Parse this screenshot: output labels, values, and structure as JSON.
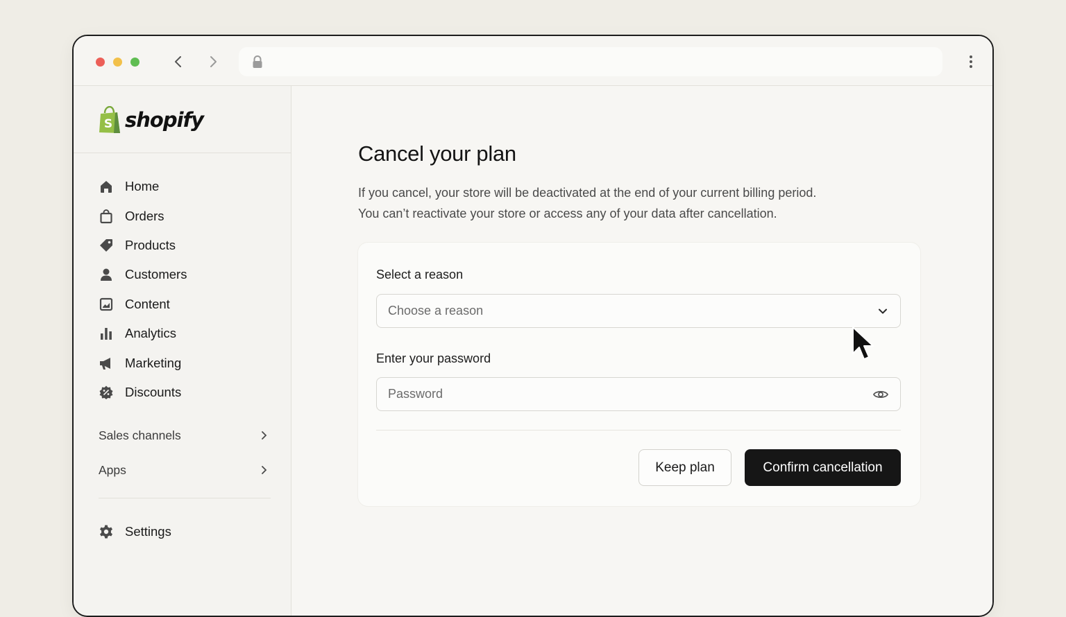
{
  "browser": {
    "url": "",
    "traffic_lights": {
      "close": "#ec5f58",
      "minimize": "#f2c04a",
      "zoom": "#5fbd52"
    }
  },
  "sidebar": {
    "brand": "shopify",
    "brand_color": "#95bf47",
    "items": [
      {
        "label": "Home",
        "icon": "home-icon"
      },
      {
        "label": "Orders",
        "icon": "orders-icon"
      },
      {
        "label": "Products",
        "icon": "tag-icon"
      },
      {
        "label": "Customers",
        "icon": "person-icon"
      },
      {
        "label": "Content",
        "icon": "content-icon"
      },
      {
        "label": "Analytics",
        "icon": "bar-chart-icon"
      },
      {
        "label": "Marketing",
        "icon": "megaphone-icon"
      },
      {
        "label": "Discounts",
        "icon": "discount-icon"
      }
    ],
    "sections": [
      {
        "label": "Sales channels"
      },
      {
        "label": "Apps"
      }
    ],
    "settings": {
      "label": "Settings",
      "icon": "gear-icon"
    }
  },
  "main": {
    "title": "Cancel your plan",
    "description_line1": "If you cancel, your store will be deactivated at the end of your current billing period.",
    "description_line2": "You can’t reactivate your store or access any of your data after cancellation.",
    "reason": {
      "label": "Select a reason",
      "placeholder": "Choose a reason"
    },
    "password": {
      "label": "Enter your password",
      "placeholder": "Password"
    },
    "buttons": {
      "keep": "Keep plan",
      "confirm": "Confirm cancellation"
    }
  }
}
